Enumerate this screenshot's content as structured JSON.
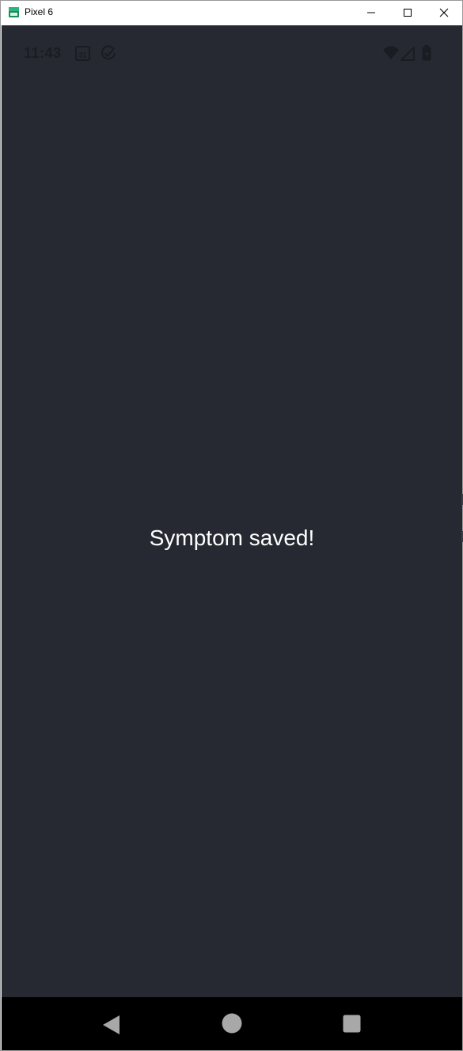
{
  "window": {
    "title": "Pixel 6"
  },
  "status_bar": {
    "time": "11:43",
    "calendar_day": "31",
    "icons": [
      "calendar-icon",
      "check-circle-icon",
      "wifi-icon",
      "cellular-signal-icon",
      "battery-icon"
    ]
  },
  "main": {
    "message": "Symptom saved!"
  },
  "nav_bar": {
    "buttons": [
      "back-icon",
      "home-icon",
      "recents-icon"
    ]
  },
  "colors": {
    "screen_background": "#262931",
    "nav_background": "#000000",
    "message_text": "#ffffff",
    "status_icons": "#1a1c22"
  }
}
